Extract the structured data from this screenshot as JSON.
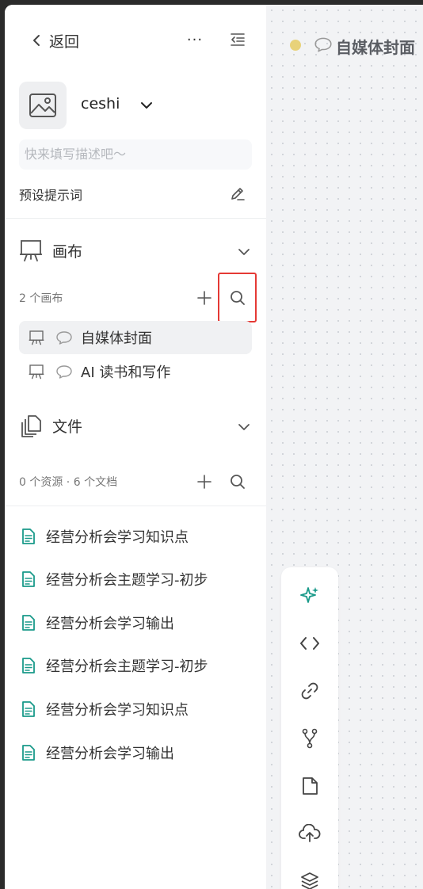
{
  "header": {
    "back_label": "返回",
    "more_label": "···"
  },
  "knowledge_base": {
    "name": "ceshi",
    "description_placeholder": "快来填写描述吧～",
    "preset_prompt_label": "预设提示词"
  },
  "canvas_section": {
    "title": "画布",
    "count": "2 个画布",
    "items": [
      {
        "label": "自媒体封面",
        "active": true
      },
      {
        "label": "AI 读书和写作",
        "active": false
      }
    ]
  },
  "files_section": {
    "title": "文件",
    "count": "0 个资源 · 6 个文档",
    "items": [
      {
        "label": "经营分析会学习知识点"
      },
      {
        "label": "经营分析会主题学习-初步"
      },
      {
        "label": "经营分析会学习输出"
      },
      {
        "label": "经营分析会主题学习-初步"
      },
      {
        "label": "经营分析会学习知识点"
      },
      {
        "label": "经营分析会学习输出"
      }
    ]
  },
  "canvas_view": {
    "title": "自媒体封面",
    "status_color": "#e8d27a"
  },
  "toolbar": {
    "icons": [
      "sparkles-icon",
      "code-icon",
      "link-icon",
      "branch-icon",
      "document-icon",
      "cloud-upload-icon",
      "layers-icon"
    ],
    "accent_color": "#1a9a8a"
  },
  "colors": {
    "file_icon": "#1a9a8a",
    "highlight": "#e53935"
  }
}
